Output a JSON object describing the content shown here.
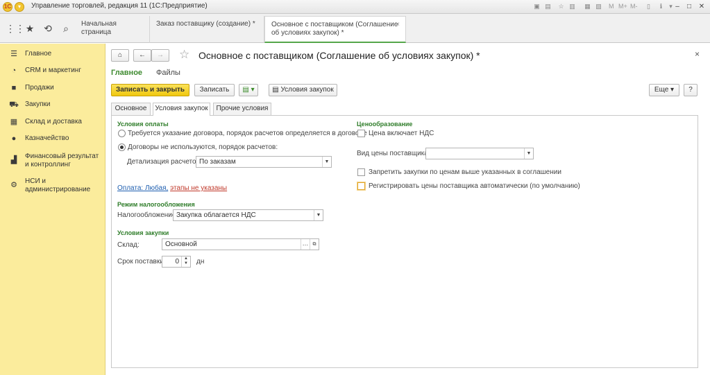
{
  "window": {
    "title": "Управление торговлей, редакция 11  (1С:Предприятие)",
    "toolbar_m_labels": [
      "M",
      "M+",
      "M-"
    ]
  },
  "navbar": {
    "tabs": [
      {
        "label": "Начальная страница"
      },
      {
        "label": "Заказ поставщику (создание) *"
      },
      {
        "label_line1": "Основное с поставщиком (Соглашение",
        "label_line2": "об условиях закупок) *"
      }
    ]
  },
  "sidebar": {
    "items": [
      {
        "icon": "menu-lines-icon",
        "label": "Главное"
      },
      {
        "icon": "pie-chart-icon",
        "label": "CRM и маркетинг"
      },
      {
        "icon": "bag-icon",
        "label": "Продажи"
      },
      {
        "icon": "cart-icon",
        "label": "Закупки"
      },
      {
        "icon": "warehouse-icon",
        "label": "Склад и доставка"
      },
      {
        "icon": "coin-icon",
        "label": "Казначейство"
      },
      {
        "icon": "bar-chart-icon",
        "label": "Финансовый результат и контроллинг"
      },
      {
        "icon": "gear-icon",
        "label": "НСИ и администрирование"
      }
    ]
  },
  "document": {
    "title": "Основное с поставщиком (Соглашение об условиях закупок) *",
    "links": {
      "main": "Главное",
      "files": "Файлы"
    },
    "buttons": {
      "save_close": "Записать и закрыть",
      "save": "Записать",
      "purchase_terms": "Условия закупок",
      "more": "Еще",
      "help": "?"
    },
    "form_tabs": [
      "Основное",
      "Условия закупок",
      "Прочие условия"
    ]
  },
  "payment": {
    "section": "Условия оплаты",
    "option1": "Требуется указание договора, порядок расчетов определяется в договоре",
    "option2": "Договоры не используются, порядок расчетов:",
    "detail_label": "Детализация расчетов:",
    "detail_value": "По заказам",
    "payment_link": "Оплата: Любая,",
    "stages_link": "этапы не указаны"
  },
  "tax": {
    "section": "Режим налогообложения",
    "label": "Налогообложение:",
    "value": "Закупка облагается НДС"
  },
  "purchase": {
    "section": "Условия закупки",
    "warehouse_label": "Склад:",
    "warehouse_value": "Основной",
    "delivery_label": "Срок поставки:",
    "delivery_value": "0",
    "delivery_unit": "дн"
  },
  "pricing": {
    "section": "Ценообразование",
    "includes_vat": "Цена включает НДС",
    "price_type_label": "Вид цены поставщика:",
    "price_type_value": "",
    "forbid_label": "Запретить закупки по ценам выше указанных в соглашении",
    "register_label": "Регистрировать цены поставщика автоматически (по умолчанию)"
  }
}
